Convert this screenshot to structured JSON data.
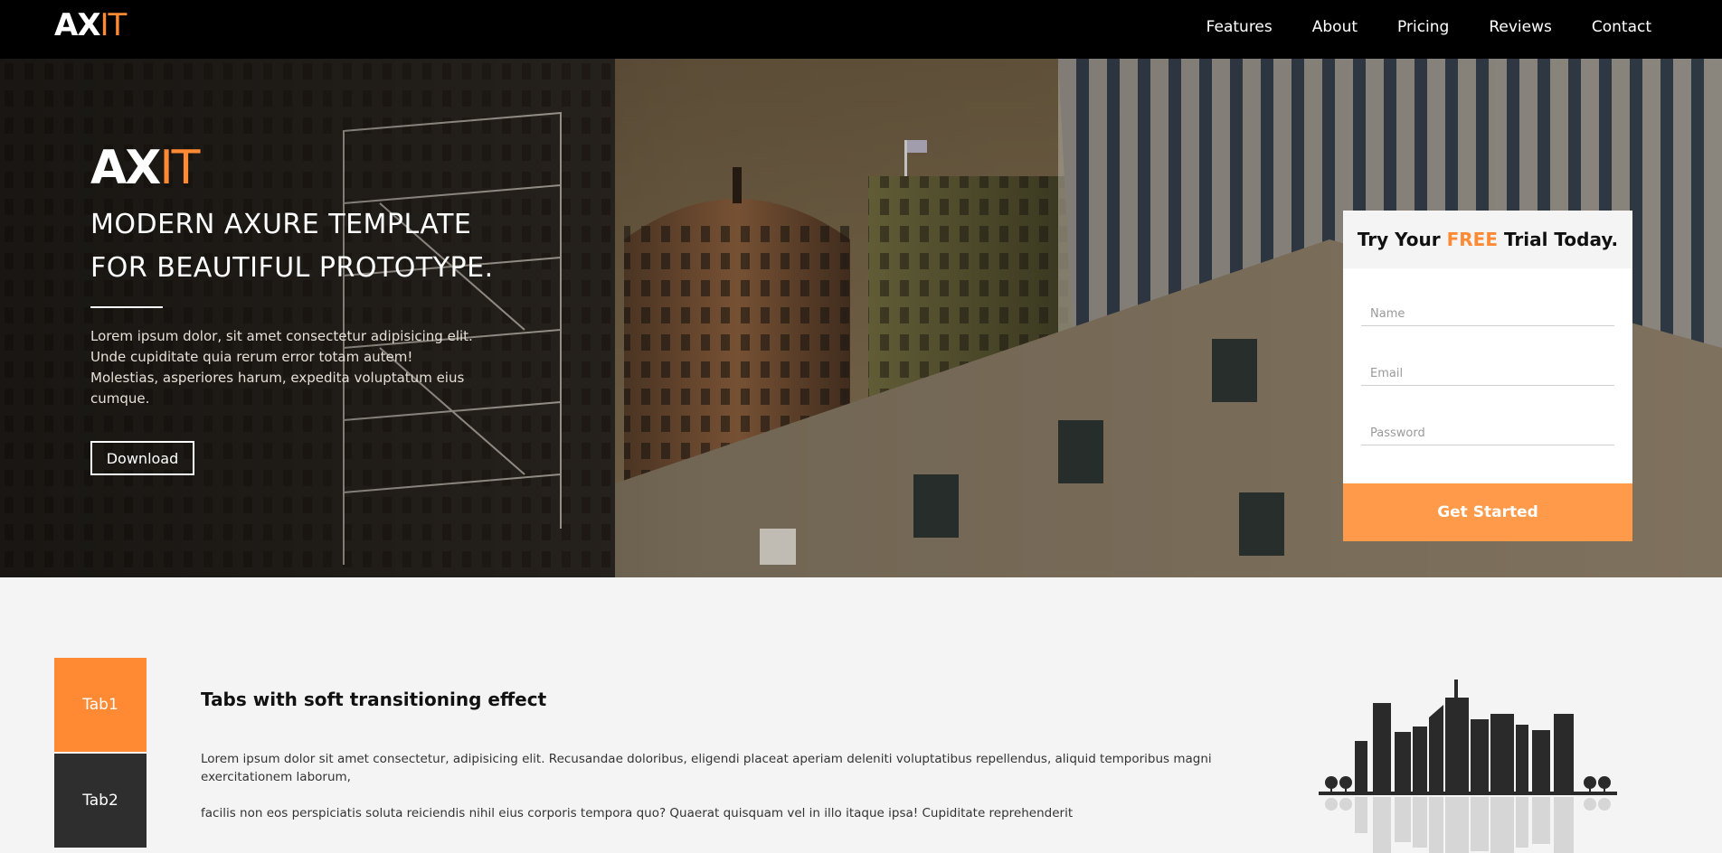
{
  "nav": {
    "brand_ax": "AX",
    "brand_it": "IT",
    "links": [
      "Features",
      "About",
      "Pricing",
      "Reviews",
      "Contact"
    ]
  },
  "hero": {
    "brand_ax": "AX",
    "brand_it": "IT",
    "title_line1": "MODERN AXURE TEMPLATE",
    "title_line2": "FOR BEAUTIFUL PROTOTYPE.",
    "description": "Lorem ipsum dolor, sit amet consectetur adipisicing elit. Unde cupiditate quia rerum error totam autem! Molestias, asperiores harum, expedita voluptatum eius cumque.",
    "download_label": "Download"
  },
  "trial": {
    "heading_prefix": "Try Your ",
    "heading_free": "FREE",
    "heading_suffix": " Trial Today.",
    "name_placeholder": "Name",
    "email_placeholder": "Email",
    "password_placeholder": "Password",
    "submit_label": "Get Started"
  },
  "tabs": {
    "items": [
      "Tab1",
      "Tab2"
    ],
    "title": "Tabs with soft transitioning effect",
    "paragraph1": "Lorem ipsum dolor sit amet consectetur, adipisicing elit. Recusandae doloribus, eligendi placeat aperiam deleniti voluptatibus repellendus, aliquid temporibus magni exercitationem laborum,",
    "paragraph2": "facilis non eos perspiciatis soluta reiciendis nihil eius corporis tempora quo? Quaerat quisquam vel in illo itaque ipsa! Cupiditate reprehenderit"
  },
  "colors": {
    "accent": "#ff8a33",
    "button_accent": "#ff9a4a",
    "nav_bg": "#000000",
    "tab_inactive": "#2e2e2e"
  }
}
